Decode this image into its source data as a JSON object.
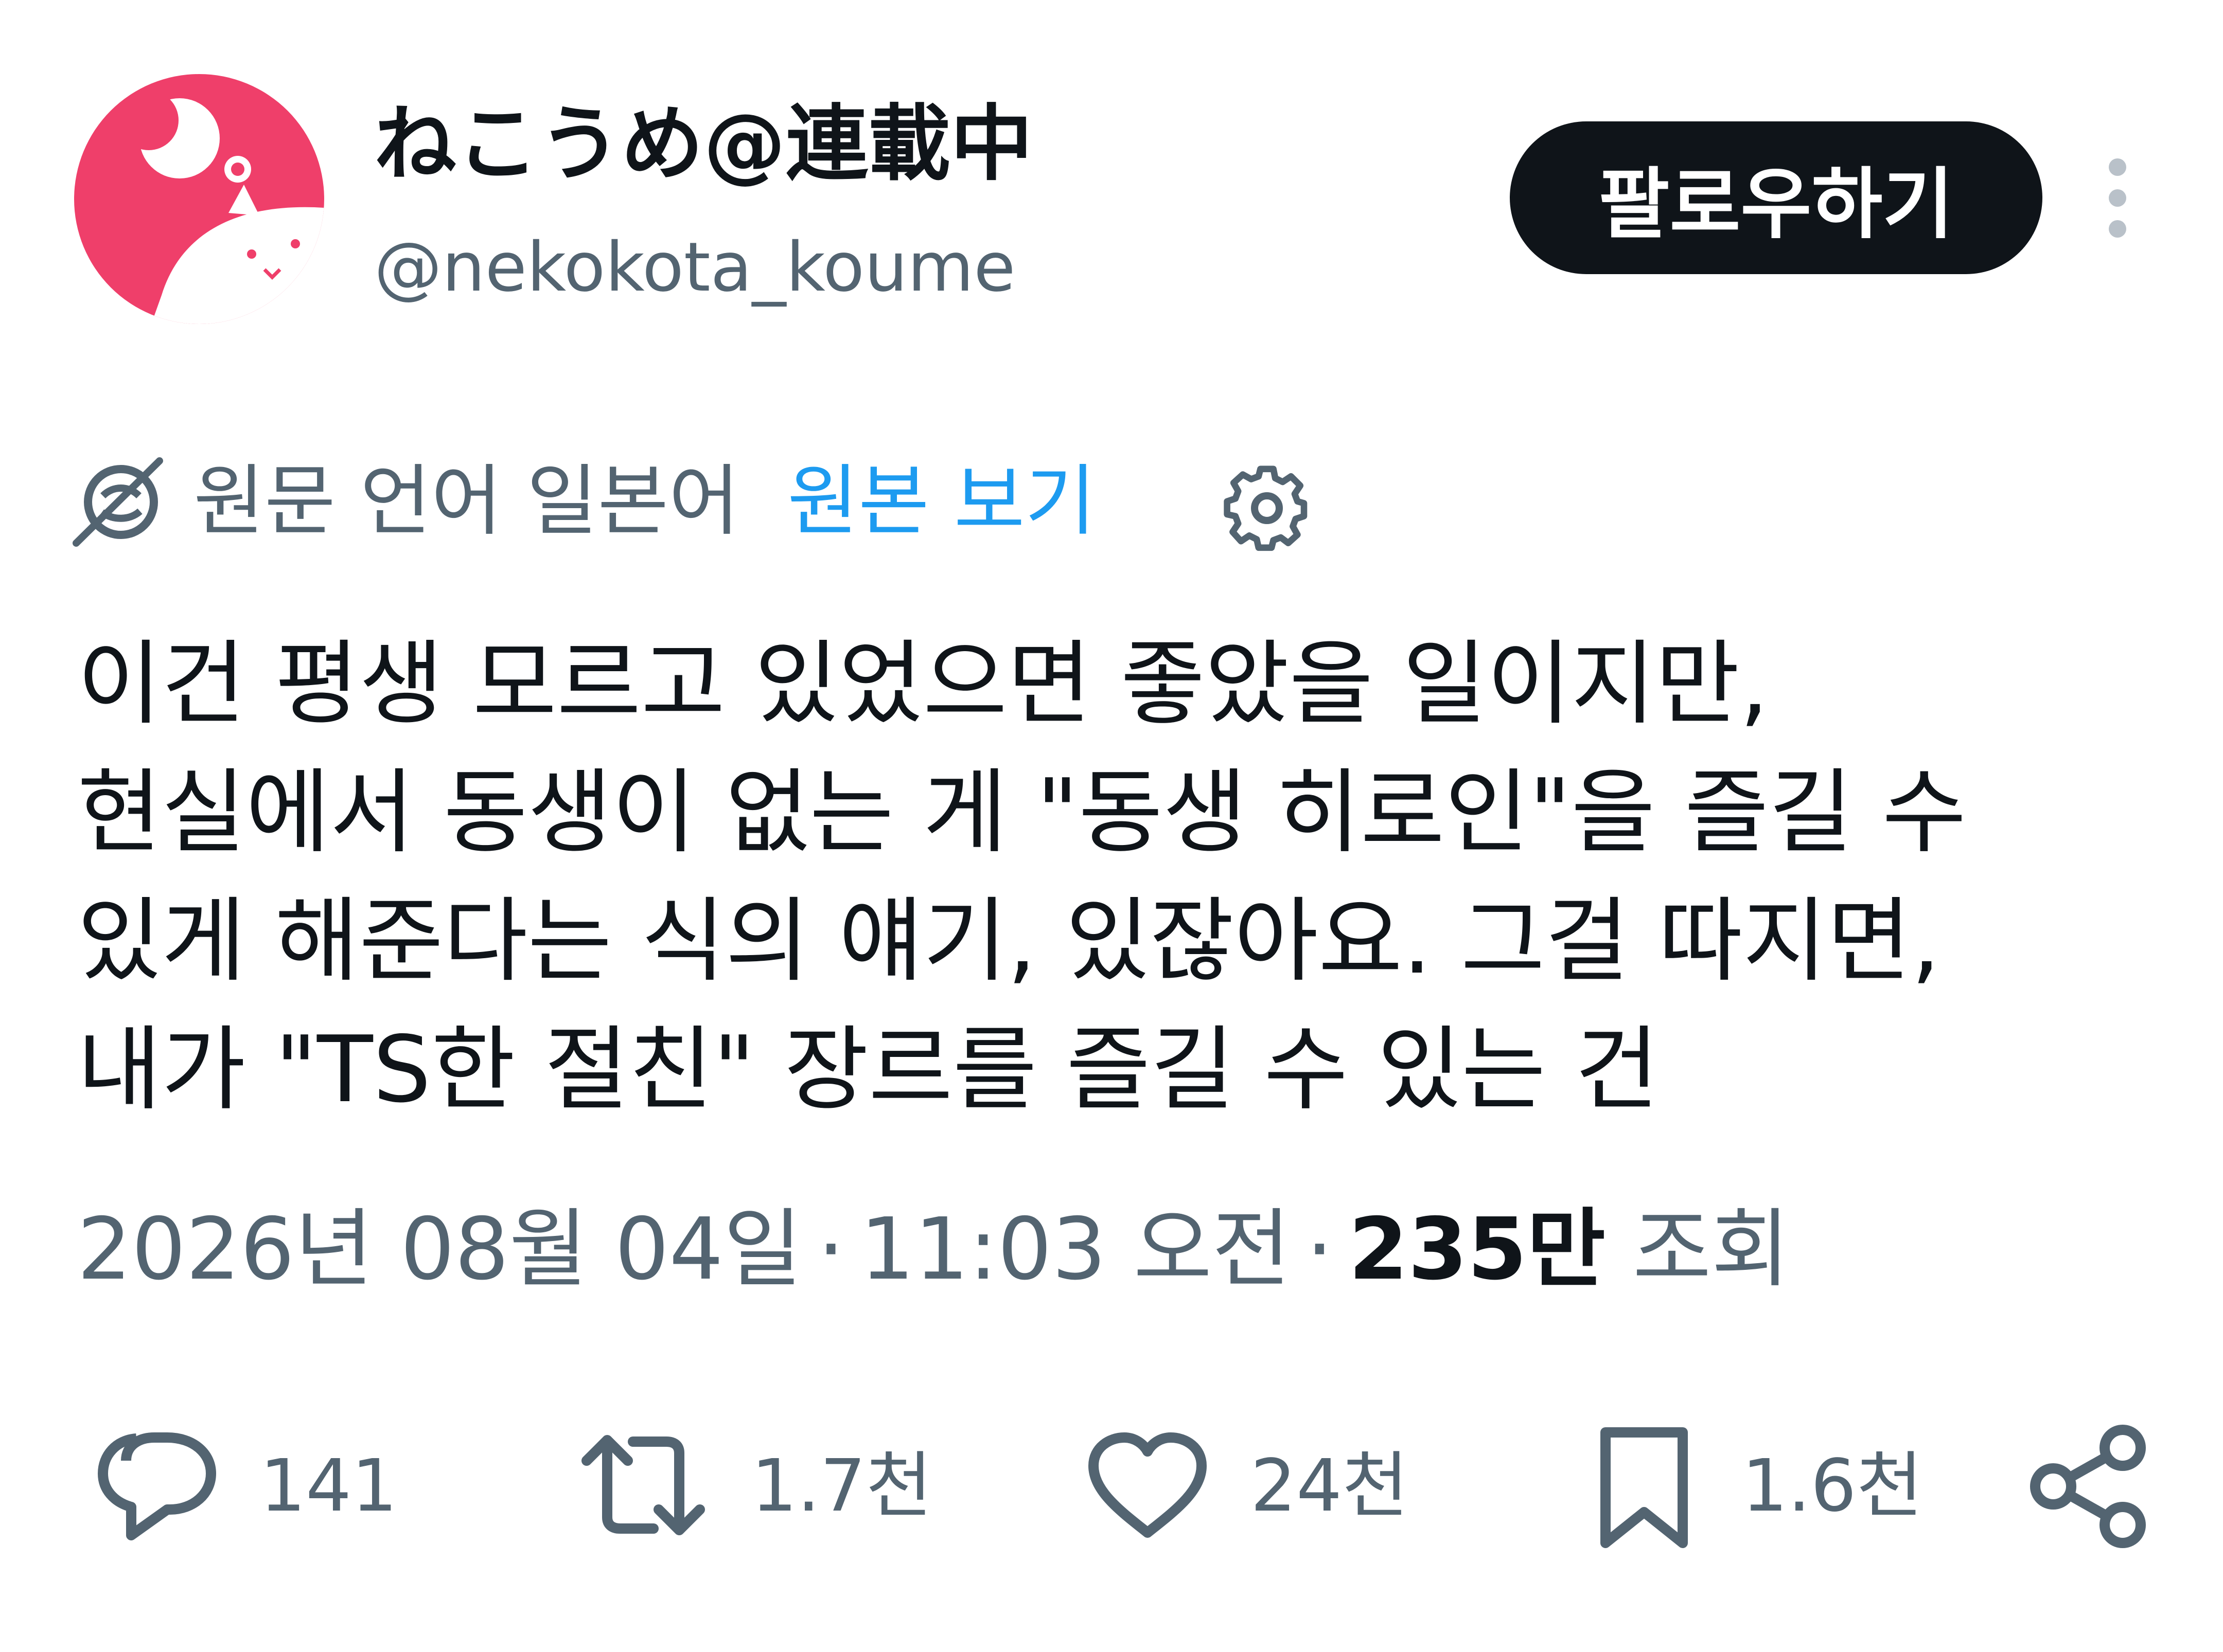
{
  "author": {
    "display_name": "ねこうめ@連載中",
    "handle": "@nekokota_koume",
    "avatar_icon": "cat-avatar-icon",
    "avatar_color": "#ef3f6a"
  },
  "header": {
    "follow_label": "팔로우하기",
    "more_icon": "vertical-dots-icon"
  },
  "translation": {
    "icon": "globe-translate-icon",
    "original_language_label": "원문 언어 일본어",
    "view_original_label": "원본 보기",
    "settings_icon": "gear-icon",
    "link_color": "#1d9bf0"
  },
  "tweet": {
    "lines": [
      "이건 평생 모르고 있었으면 좋았을 일이지만,",
      "현실에서 동생이 없는 게 \"동생 히로인\"을 즐길 수",
      "있게 해준다는 식의 얘기, 있잖아요. 그걸 따지면,",
      "내가 \"TS한 절친\" 장르를 즐길 수 있는 건"
    ]
  },
  "meta": {
    "date": "2026년 08월 04일",
    "separator": "·",
    "time": "11:03 오전",
    "views_count": "235만",
    "views_label": "조회"
  },
  "actions": {
    "reply": {
      "icon": "reply-icon",
      "count": "141"
    },
    "retweet": {
      "icon": "retweet-icon",
      "count": "1.7천"
    },
    "like": {
      "icon": "heart-icon",
      "count": "24천"
    },
    "bookmark": {
      "icon": "bookmark-icon",
      "count": "1.6천"
    },
    "share": {
      "icon": "share-icon"
    }
  },
  "colors": {
    "text_primary": "#0f1419",
    "text_secondary": "#536471",
    "icon_color": "#536471"
  }
}
